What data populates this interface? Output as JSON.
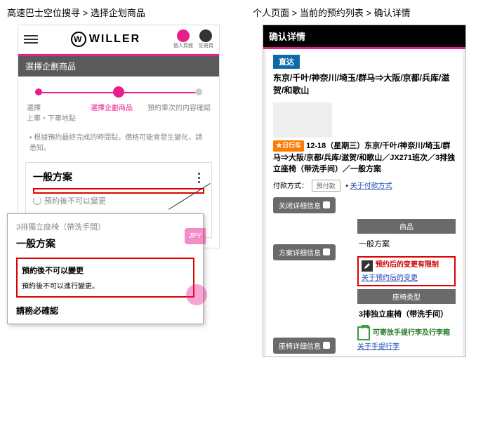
{
  "left": {
    "breadcrumb": "高速巴士空位搜寻 > 选择企划商品",
    "logo_text": "WILLER",
    "header_icons": {
      "login": "個人頁面",
      "member": "註冊頁"
    },
    "section_title": "選擇企劃商品",
    "steps": {
      "s1": {
        "l1": "選擇",
        "l2": "上車・下車地點"
      },
      "s2": "選擇企劃商品",
      "s3": "預約車次的内容確認"
    },
    "note": "根據預約最終完成的時間點，價格可能會發生變化，請悉知。",
    "plan": {
      "title": "一般方案",
      "no_change": "預約後不可以變更"
    },
    "popup": {
      "subtitle": "3排獨立座椅（帶洗手間）",
      "title": "一般方案",
      "warn_title": "預約後不可以變更",
      "warn_body": "預約後不可以進行變更。",
      "confirm": "請務必確認",
      "jpy": "JPY"
    }
  },
  "right": {
    "breadcrumb": "个人页面 > 当前的预约列表 > 确认详情",
    "title": "确认详情",
    "direct_badge": "直达",
    "route": "东京/千叶/神奈川/埼玉/群马⇒大阪/京都/兵库/滋贺/和歌山",
    "day_badge": "★日行车",
    "desc": "12-18（星期三）东京/千叶/神奈川/埼玉/群马⇒大阪/京都/兵库/滋贺/和歌山／JX271班次／3排独立座椅（带洗手间）／一般方案",
    "pay_label": "付款方式：",
    "pay_chip": "预付款",
    "pay_link": "关于付款方式",
    "btn_close": "关闭详细信息",
    "btn_plan": "方案详细信息",
    "btn_seat": "座椅详细信息",
    "sec_product": "商品",
    "product_name": "一般方案",
    "change_limited": "预约后的变更有限制",
    "change_link": "关于预约后的变更",
    "sec_seat": "座椅类型",
    "seat_name": "3排独立座椅（带洗手间）",
    "luggage_text": "可寄放手提行李及行李箱",
    "luggage_link": "关于手提行李"
  }
}
